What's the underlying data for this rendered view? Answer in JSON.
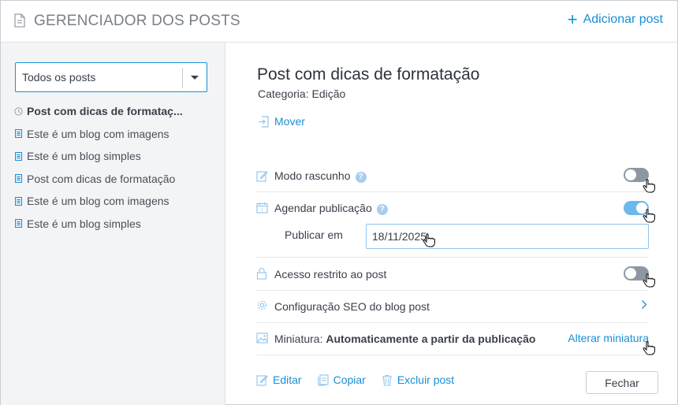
{
  "header": {
    "title": "GERENCIADOR DOS POSTS",
    "add_post_label": "Adicionar post",
    "add_icon": "plus-icon",
    "doc_icon": "document-icon"
  },
  "sidebar": {
    "select_value": "Todos os posts",
    "posts": [
      {
        "label": "Post com dicas de formataç...",
        "icon": "clock-icon",
        "active": true
      },
      {
        "label": "Este é um blog com imagens",
        "icon": "document-icon",
        "active": false
      },
      {
        "label": "Este é um blog simples",
        "icon": "document-icon",
        "active": false
      },
      {
        "label": "Post com dicas de formatação",
        "icon": "document-icon",
        "active": false
      },
      {
        "label": "Este é um blog com imagens",
        "icon": "document-icon",
        "active": false
      },
      {
        "label": "Este é um blog simples",
        "icon": "document-icon",
        "active": false
      }
    ]
  },
  "main": {
    "post_title": "Post com dicas de formatação",
    "category": "Categoria: Edição",
    "move_label": "Mover",
    "draft_label": "Modo rascunho",
    "draft_on": false,
    "schedule_label": "Agendar publicação",
    "schedule_on": true,
    "publish_at_label": "Publicar em",
    "publish_date": "18/11/2025",
    "restricted_label": "Acesso restrito ao post",
    "restricted_on": false,
    "seo_label": "Configuração SEO do blog post",
    "thumbnail_prefix": "Miniatura: ",
    "thumbnail_value": "Automaticamente a partir da publicação",
    "change_thumbnail": "Alterar miniatura",
    "help_glyph": "?",
    "actions": {
      "edit": "Editar",
      "copy": "Copiar",
      "delete": "Excluir post",
      "close": "Fechar"
    }
  },
  "colors": {
    "accent": "#1a8fd6",
    "toggle_on": "#6cb9ec",
    "toggle_off": "#8f96a3",
    "sidebar_bg": "#f3f4f6"
  }
}
